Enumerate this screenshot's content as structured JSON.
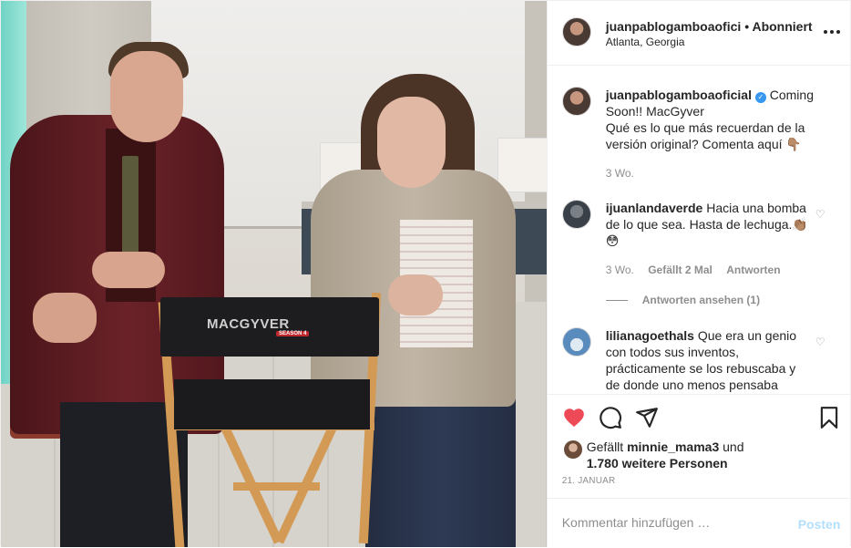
{
  "header": {
    "username": "juanpablogamboaofici",
    "separator": "•",
    "follow_status": "Abonniert",
    "location": "Atlanta, Georgia"
  },
  "photo": {
    "chair_brand": "MACGYVER",
    "chair_badge": "SEASON 4"
  },
  "caption": {
    "username": "juanpablogamboaoficial",
    "verified_mark": "✓",
    "text_1": "Coming Soon!! MacGyver",
    "text_2": "Qué es lo que más recuerdan de la versión original? Comenta aquí 👇🏽",
    "age": "3 Wo."
  },
  "comments": [
    {
      "username": "ijuanlandaverde",
      "text": "Hacia una bomba de lo que sea. Hasta de lechuga.👏🏽😳",
      "age": "3 Wo.",
      "likes": "Gefällt 2 Mal",
      "reply": "Antworten",
      "view_replies": "Antworten ansehen (1)"
    },
    {
      "username": "lilianagoethals",
      "text": "Que era un genio con todos sus inventos, prácticamente se los rebuscaba y de donde uno menos pensaba"
    }
  ],
  "likes": {
    "prefix": "Gefällt",
    "user": "minnie_mama3",
    "middle": "und",
    "others": "1.780 weitere Personen"
  },
  "date": "21. JANUAR",
  "add_comment": {
    "placeholder": "Kommentar hinzufügen …",
    "post_label": "Posten"
  },
  "icons": {
    "like": "heart-filled-icon",
    "comment": "comment-icon",
    "share": "send-icon",
    "save": "bookmark-icon",
    "more": "more-icon"
  },
  "colors": {
    "like_red": "#ed4956",
    "verified_blue": "#3897f0",
    "post_disabled": "#b2dffc",
    "muted": "#8e8e8e"
  }
}
